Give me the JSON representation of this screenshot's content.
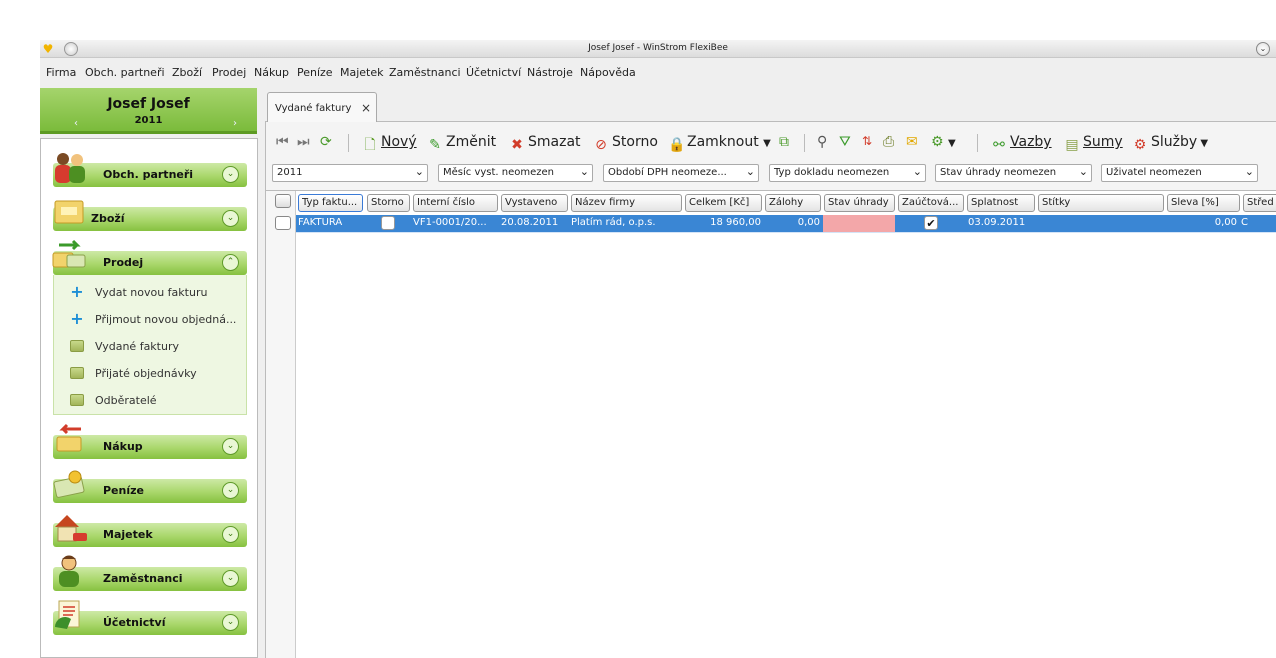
{
  "window": {
    "title": "Josef Josef - WinStrom FlexiBee"
  },
  "menu": [
    "Firma",
    "Obch. partneři",
    "Zboží",
    "Prodej",
    "Nákup",
    "Peníze",
    "Majetek",
    "Zaměstnanci",
    "Účetnictví",
    "Nástroje",
    "Nápověda"
  ],
  "user": {
    "name": "Josef Josef",
    "year": "2011",
    "prev": "‹",
    "next": "›"
  },
  "nav": {
    "sections": [
      "Obch. partneři",
      "Zboží",
      "Prodej",
      "Nákup",
      "Peníze",
      "Majetek",
      "Zaměstnanci",
      "Účetnictví"
    ],
    "prodej_items": [
      "Vydat novou fakturu",
      "Přijmout novou objedná...",
      "Vydané faktury",
      "Přijaté objednávky",
      "Odběratelé"
    ]
  },
  "tab": {
    "label": "Vydané faktury",
    "close": "×"
  },
  "toolbar": {
    "new": "Nový",
    "edit": "Změnit",
    "delete": "Smazat",
    "storno": "Storno",
    "lock": "Zamknout",
    "links": "Vazby",
    "sums": "Sumy",
    "services": "Služby"
  },
  "filters": [
    "2011",
    "Měsíc vyst. neomezen",
    "Období DPH neomeze...",
    "Typ dokladu neomezen",
    "Stav úhrady neomezen",
    "Uživatel neomezen"
  ],
  "columns": [
    "Typ faktu...",
    "Storno",
    "Interní číslo",
    "Vystaveno",
    "Název firmy",
    "Celkem [Kč]",
    "Zálohy",
    "Stav úhrady",
    "Zaúčtová...",
    "Splatnost",
    "Štítky",
    "Sleva [%]",
    "Střed"
  ],
  "rows": [
    {
      "typ": "FAKTURA",
      "interni": "VF1-0001/20...",
      "vystaveno": "20.08.2011",
      "firma": "Platím rád, o.p.s.",
      "celkem": "18 960,00",
      "zalohy": "0,00",
      "zauctovano": "✔",
      "splatnost": "03.09.2011",
      "sleva": "0,00",
      "stred": "C"
    }
  ],
  "colors": {
    "accent_green": "#86c140",
    "selection_blue": "#3a86d4",
    "unpaid_red": "#f3a7a9"
  }
}
